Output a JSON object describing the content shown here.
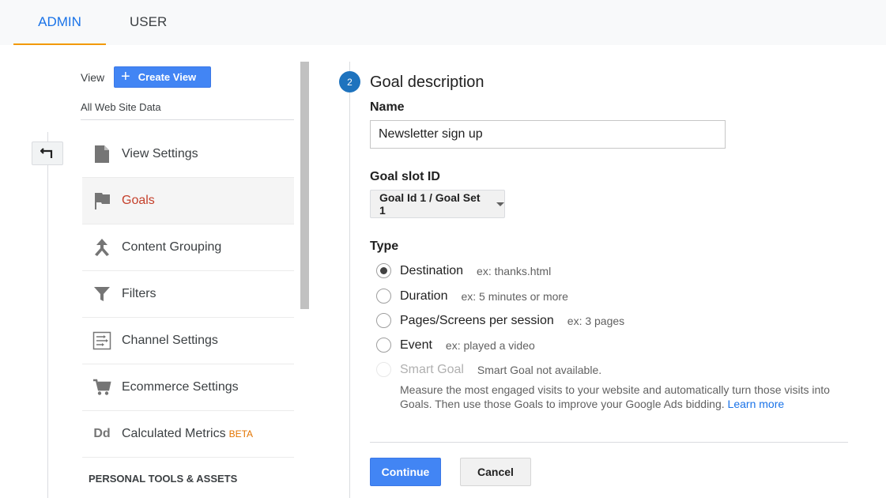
{
  "tabs": [
    {
      "label": "ADMIN",
      "active": true
    },
    {
      "label": "USER",
      "active": false
    }
  ],
  "view": {
    "label": "View",
    "create_button": "Create View",
    "name": "All Web Site Data"
  },
  "nav": {
    "items": [
      {
        "label": "View Settings",
        "icon": "document-icon"
      },
      {
        "label": "Goals",
        "icon": "flag-icon",
        "active": true
      },
      {
        "label": "Content Grouping",
        "icon": "grouping-icon"
      },
      {
        "label": "Filters",
        "icon": "filter-icon"
      },
      {
        "label": "Channel Settings",
        "icon": "channel-icon"
      },
      {
        "label": "Ecommerce Settings",
        "icon": "cart-icon"
      },
      {
        "label": "Calculated Metrics",
        "icon": "dd-icon",
        "badge": "BETA"
      }
    ],
    "section_title": "PERSONAL TOOLS & ASSETS"
  },
  "goal": {
    "step": "2",
    "title": "Goal description",
    "name_label": "Name",
    "name_value": "Newsletter sign up",
    "slot_label": "Goal slot ID",
    "slot_value": "Goal Id 1 / Goal Set 1",
    "type_label": "Type",
    "types": [
      {
        "label": "Destination",
        "example": "ex: thanks.html",
        "checked": true
      },
      {
        "label": "Duration",
        "example": "ex: 5 minutes or more"
      },
      {
        "label": "Pages/Screens per session",
        "example": "ex: 3 pages"
      },
      {
        "label": "Event",
        "example": "ex: played a video"
      },
      {
        "label": "Smart Goal",
        "example": "Smart Goal not available.",
        "disabled": true
      }
    ],
    "smart_note": "Measure the most engaged visits to your website and automatically turn those visits into Goals. Then use those Goals to improve your Google Ads bidding.",
    "smart_link": "Learn more",
    "continue": "Continue",
    "cancel": "Cancel"
  },
  "colors": {
    "accent": "#4285f4",
    "active_nav": "#c5402b",
    "tab_underline": "#f29900",
    "step_circle": "#1e73be"
  }
}
